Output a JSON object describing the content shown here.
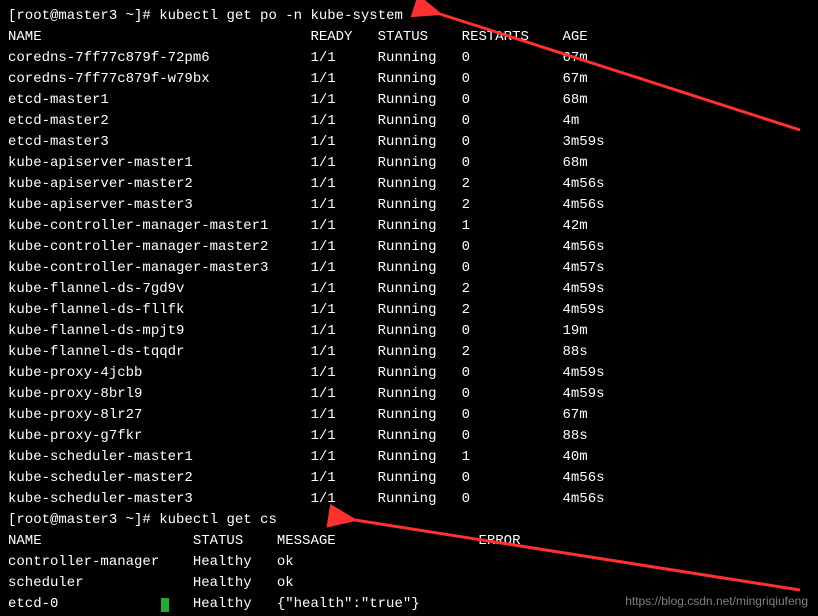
{
  "prompt1": {
    "prefix": "[root@master3 ~]# ",
    "command": "kubectl get po -n kube-system"
  },
  "table1": {
    "headers": {
      "name": "NAME",
      "ready": "READY",
      "status": "STATUS",
      "restarts": "RESTARTS",
      "age": "AGE"
    },
    "rows": [
      {
        "name": "coredns-7ff77c879f-72pm6",
        "ready": "1/1",
        "status": "Running",
        "restarts": "0",
        "age": "67m"
      },
      {
        "name": "coredns-7ff77c879f-w79bx",
        "ready": "1/1",
        "status": "Running",
        "restarts": "0",
        "age": "67m"
      },
      {
        "name": "etcd-master1",
        "ready": "1/1",
        "status": "Running",
        "restarts": "0",
        "age": "68m"
      },
      {
        "name": "etcd-master2",
        "ready": "1/1",
        "status": "Running",
        "restarts": "0",
        "age": "4m"
      },
      {
        "name": "etcd-master3",
        "ready": "1/1",
        "status": "Running",
        "restarts": "0",
        "age": "3m59s"
      },
      {
        "name": "kube-apiserver-master1",
        "ready": "1/1",
        "status": "Running",
        "restarts": "0",
        "age": "68m"
      },
      {
        "name": "kube-apiserver-master2",
        "ready": "1/1",
        "status": "Running",
        "restarts": "2",
        "age": "4m56s"
      },
      {
        "name": "kube-apiserver-master3",
        "ready": "1/1",
        "status": "Running",
        "restarts": "2",
        "age": "4m56s"
      },
      {
        "name": "kube-controller-manager-master1",
        "ready": "1/1",
        "status": "Running",
        "restarts": "1",
        "age": "42m"
      },
      {
        "name": "kube-controller-manager-master2",
        "ready": "1/1",
        "status": "Running",
        "restarts": "0",
        "age": "4m56s"
      },
      {
        "name": "kube-controller-manager-master3",
        "ready": "1/1",
        "status": "Running",
        "restarts": "0",
        "age": "4m57s"
      },
      {
        "name": "kube-flannel-ds-7gd9v",
        "ready": "1/1",
        "status": "Running",
        "restarts": "2",
        "age": "4m59s"
      },
      {
        "name": "kube-flannel-ds-fllfk",
        "ready": "1/1",
        "status": "Running",
        "restarts": "2",
        "age": "4m59s"
      },
      {
        "name": "kube-flannel-ds-mpjt9",
        "ready": "1/1",
        "status": "Running",
        "restarts": "0",
        "age": "19m"
      },
      {
        "name": "kube-flannel-ds-tqqdr",
        "ready": "1/1",
        "status": "Running",
        "restarts": "2",
        "age": "88s"
      },
      {
        "name": "kube-proxy-4jcbb",
        "ready": "1/1",
        "status": "Running",
        "restarts": "0",
        "age": "4m59s"
      },
      {
        "name": "kube-proxy-8brl9",
        "ready": "1/1",
        "status": "Running",
        "restarts": "0",
        "age": "4m59s"
      },
      {
        "name": "kube-proxy-8lr27",
        "ready": "1/1",
        "status": "Running",
        "restarts": "0",
        "age": "67m"
      },
      {
        "name": "kube-proxy-g7fkr",
        "ready": "1/1",
        "status": "Running",
        "restarts": "0",
        "age": "88s"
      },
      {
        "name": "kube-scheduler-master1",
        "ready": "1/1",
        "status": "Running",
        "restarts": "1",
        "age": "40m"
      },
      {
        "name": "kube-scheduler-master2",
        "ready": "1/1",
        "status": "Running",
        "restarts": "0",
        "age": "4m56s"
      },
      {
        "name": "kube-scheduler-master3",
        "ready": "1/1",
        "status": "Running",
        "restarts": "0",
        "age": "4m56s"
      }
    ]
  },
  "prompt2": {
    "prefix": "[root@master3 ~]# ",
    "command": "kubectl get cs"
  },
  "table2": {
    "headers": {
      "name": "NAME",
      "status": "STATUS",
      "message": "MESSAGE",
      "error": "ERROR"
    },
    "rows": [
      {
        "name": "controller-manager",
        "status": "Healthy",
        "message": "ok",
        "error": ""
      },
      {
        "name": "scheduler",
        "status": "Healthy",
        "message": "ok",
        "error": ""
      },
      {
        "name": "etcd-0",
        "status": "Healthy",
        "message": "{\"health\":\"true\"}",
        "error": ""
      }
    ]
  },
  "watermark": "https://blog.csdn.net/mingriqiufeng",
  "colors": {
    "arrow": "#ff3030"
  },
  "cols": {
    "t1": {
      "name": 0,
      "ready": 36,
      "status": 44,
      "restarts": 54,
      "age": 66
    },
    "t2": {
      "name": 0,
      "status": 22,
      "message": 32,
      "error": 56
    }
  }
}
